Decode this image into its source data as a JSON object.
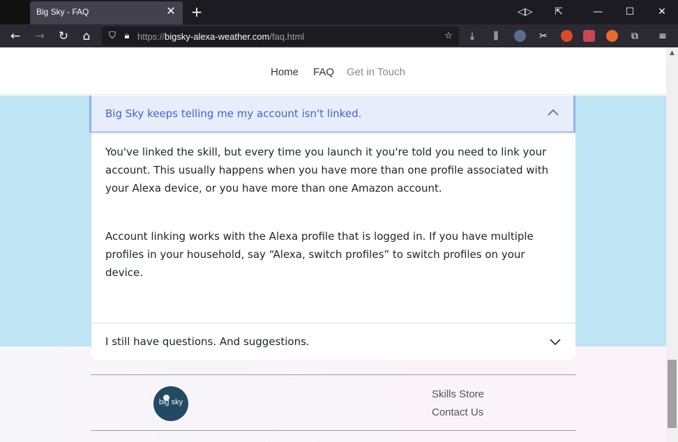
{
  "browser": {
    "tab_title": "Big Sky - FAQ",
    "url_prefix": "https://",
    "url_domain": "bigsky-alexa-weather.com",
    "url_path": "/faq.html"
  },
  "site_nav": {
    "home": "Home",
    "faq": "FAQ",
    "contact": "Get in Touch"
  },
  "faq": {
    "item1_question": "Big Sky keeps telling me my account isn't linked.",
    "item1_paragraph1": "You've linked the skill, but every time you launch it you're told you need to link your account. This usually happens when you have more than one profile associated with your Alexa device, or you have more than one Amazon account.",
    "item1_paragraph2": "Account linking works with the Alexa profile that is logged in. If you have multiple profiles in your household, say “Alexa, switch profiles” to switch profiles on your device.",
    "item2_question": "I still have questions. And suggestions."
  },
  "footer": {
    "logo_text": "big sky",
    "skills_store": "Skills Store",
    "contact_us": "Contact Us"
  },
  "colors": {
    "accent": "#3e63cf",
    "band": "#bfe4f4"
  }
}
